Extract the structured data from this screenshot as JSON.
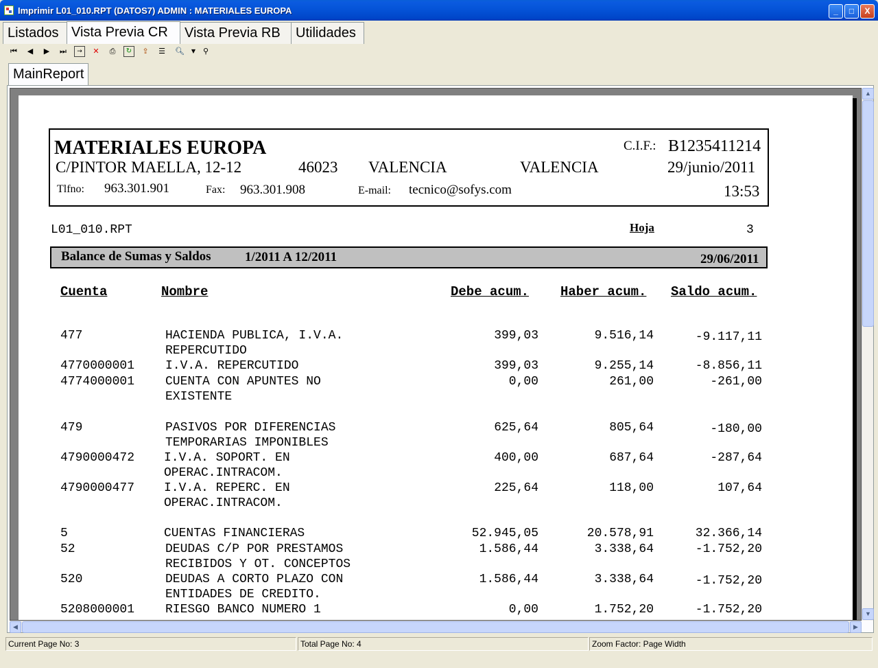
{
  "window": {
    "title": "Imprimir L01_010.RPT (DATOS7) ADMIN : MATERIALES EUROPA",
    "controls": [
      "_",
      "□",
      "X"
    ]
  },
  "tabs": [
    {
      "label": "Listados",
      "active": false
    },
    {
      "label": "Vista Previa CR",
      "active": true
    },
    {
      "label": "Vista Previa RB",
      "active": false
    },
    {
      "label": "Utilidades",
      "active": false
    }
  ],
  "toolbar": {
    "icons": [
      "first-page-icon",
      "prev-page-icon",
      "next-page-icon",
      "last-page-icon",
      "goto-page-icon",
      "stop-icon",
      "print-icon",
      "refresh-icon",
      "export-icon",
      "group-tree-icon",
      "zoom-icon",
      "zoom-dropdown-icon",
      "search-icon"
    ]
  },
  "subtab": {
    "label": "MainReport"
  },
  "report": {
    "company": "MATERIALES EUROPA",
    "cif_label": "C.I.F.:",
    "cif": "B1235411214",
    "address": "C/PINTOR MAELLA, 12-12",
    "zip": "46023",
    "city": "VALENCIA",
    "province": "VALENCIA",
    "date_long": "29/junio/2011",
    "phone_label": "Tlfno:",
    "phone": "963.301.901",
    "fax_label": "Fax:",
    "fax": "963.301.908",
    "email_label": "E-mail:",
    "email": "tecnico@sofys.com",
    "time": "13:53",
    "report_file": "L01_010.RPT",
    "page_label": "Hoja",
    "page_number": "3",
    "report_title": "Balance de Sumas y Saldos",
    "period": "1/2011 A 12/2011",
    "date_short": "29/06/2011",
    "columns": {
      "cuenta": "Cuenta",
      "nombre": "Nombre",
      "debe": "Debe acum.",
      "haber": "Haber acum.",
      "saldo": "Saldo acum."
    },
    "rows": [
      {
        "code": "477",
        "name": "HACIENDA PUBLICA, I.V.A.",
        "name2": "REPERCUTIDO",
        "debe": "399,03",
        "haber": "9.516,14",
        "saldo": "-9.117,11"
      },
      {
        "code": "4770000001",
        "name": "I.V.A. REPERCUTIDO",
        "name2": "",
        "debe": "399,03",
        "haber": "9.255,14",
        "saldo": "-8.856,11"
      },
      {
        "code": "4774000001",
        "name": "CUENTA CON APUNTES NO",
        "name2": "EXISTENTE",
        "debe": "0,00",
        "haber": "261,00",
        "saldo": "-261,00"
      },
      {
        "code": "479",
        "name": "PASIVOS POR DIFERENCIAS",
        "name2": "TEMPORARIAS IMPONIBLES",
        "debe": "625,64",
        "haber": "805,64",
        "saldo": "-180,00"
      },
      {
        "code": "4790000472",
        "name": "I.V.A. SOPORT. EN",
        "name2": "OPERAC.INTRACOM.",
        "debe": "400,00",
        "haber": "687,64",
        "saldo": "-287,64"
      },
      {
        "code": "4790000477",
        "name": "I.V.A. REPERC. EN",
        "name2": "OPERAC.INTRACOM.",
        "debe": "225,64",
        "haber": "118,00",
        "saldo": "107,64"
      },
      {
        "code": "5",
        "name": "CUENTAS FINANCIERAS",
        "name2": "",
        "debe": "52.945,05",
        "haber": "20.578,91",
        "saldo": "32.366,14"
      },
      {
        "code": "52",
        "name": "DEUDAS C/P POR PRESTAMOS",
        "name2": "RECIBIDOS Y OT. CONCEPTOS",
        "debe": "1.586,44",
        "haber": "3.338,64",
        "saldo": "-1.752,20"
      },
      {
        "code": "520",
        "name": "DEUDAS A CORTO PLAZO CON",
        "name2": "ENTIDADES DE CREDITO.",
        "debe": "1.586,44",
        "haber": "3.338,64",
        "saldo": "-1.752,20"
      },
      {
        "code": "5208000001",
        "name": "RIESGO BANCO NUMERO 1",
        "name2": "",
        "debe": "0,00",
        "haber": "1.752,20",
        "saldo": "-1.752,20"
      }
    ]
  },
  "statusbar": {
    "current_page": "Current Page No: 3",
    "total_pages": "Total Page No: 4",
    "zoom": "Zoom Factor: Page Width"
  }
}
